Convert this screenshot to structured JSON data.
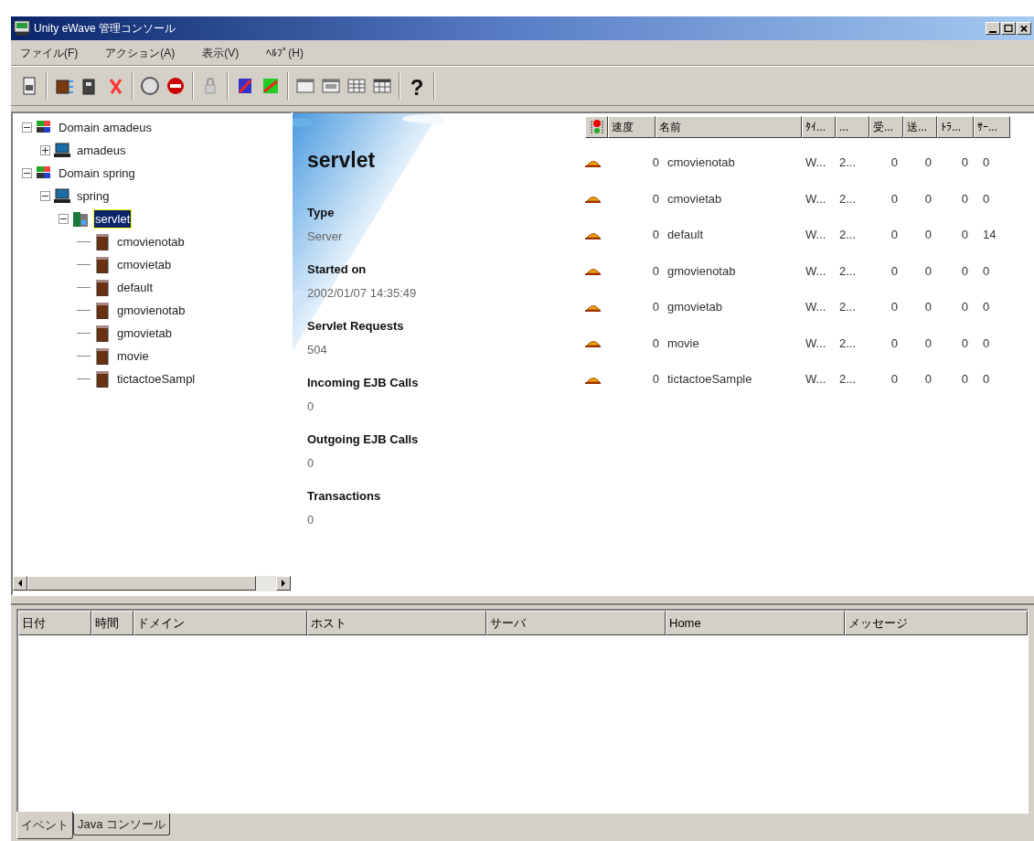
{
  "window": {
    "title": "Unity eWave 管理コンソール"
  },
  "menu": [
    "ファイル(F)",
    "アクション(A)",
    "表示(V)",
    "ﾍﾙﾌﾟ(H)"
  ],
  "toolbar": {
    "help": "?"
  },
  "tree": [
    {
      "label": "Domain amadeus",
      "kind": "domain",
      "expanded": true,
      "selected": false,
      "children": [
        {
          "label": "amadeus",
          "kind": "host",
          "expanded": false,
          "selected": false
        }
      ]
    },
    {
      "label": "Domain spring",
      "kind": "domain",
      "expanded": true,
      "selected": false,
      "children": [
        {
          "label": "spring",
          "kind": "host",
          "expanded": true,
          "selected": false,
          "children": [
            {
              "label": "servlet",
              "kind": "server",
              "expanded": true,
              "selected": true,
              "children": [
                {
                  "label": "cmovienotab",
                  "kind": "app",
                  "selected": false
                },
                {
                  "label": "cmovietab",
                  "kind": "app",
                  "selected": false
                },
                {
                  "label": "default",
                  "kind": "app",
                  "selected": false
                },
                {
                  "label": "gmovienotab",
                  "kind": "app",
                  "selected": false
                },
                {
                  "label": "gmovietab",
                  "kind": "app",
                  "selected": false
                },
                {
                  "label": "movie",
                  "kind": "app",
                  "selected": false
                },
                {
                  "label": "tictactoeSampl",
                  "kind": "app",
                  "selected": false
                }
              ]
            }
          ]
        }
      ]
    }
  ],
  "detail": {
    "title": "servlet",
    "fields": [
      {
        "label": "Type",
        "value": "Server"
      },
      {
        "label": "Started on",
        "value": "2002/01/07 14:35:49"
      },
      {
        "label": "Servlet Requests",
        "value": "504"
      },
      {
        "label": "Incoming EJB Calls",
        "value": "0"
      },
      {
        "label": "Outgoing EJB Calls",
        "value": "0"
      },
      {
        "label": "Transactions",
        "value": "0"
      }
    ]
  },
  "app_table": {
    "columns": [
      "速度",
      "名前",
      "ﾀｲ...",
      "...",
      "受...",
      "送...",
      "ﾄﾗ...",
      "ｻｰ..."
    ],
    "rows": [
      [
        "0",
        "cmovienotab",
        "W...",
        "2...",
        "0",
        "0",
        "0",
        "0"
      ],
      [
        "0",
        "cmovietab",
        "W...",
        "2...",
        "0",
        "0",
        "0",
        "0"
      ],
      [
        "0",
        "default",
        "W...",
        "2...",
        "0",
        "0",
        "0",
        "14"
      ],
      [
        "0",
        "gmovienotab",
        "W...",
        "2...",
        "0",
        "0",
        "0",
        "0"
      ],
      [
        "0",
        "gmovietab",
        "W...",
        "2...",
        "0",
        "0",
        "0",
        "0"
      ],
      [
        "0",
        "movie",
        "W...",
        "2...",
        "0",
        "0",
        "0",
        "0"
      ],
      [
        "0",
        "tictactoeSample",
        "W...",
        "2...",
        "0",
        "0",
        "0",
        "0"
      ]
    ]
  },
  "event_table": {
    "columns": [
      "日付",
      "時間",
      "ドメイン",
      "ホスト",
      "サーバ",
      "Home",
      "メッセージ"
    ]
  },
  "bottom_tabs": [
    {
      "label": "イベント",
      "selected": true
    },
    {
      "label": "Java コンソール",
      "selected": false
    }
  ]
}
